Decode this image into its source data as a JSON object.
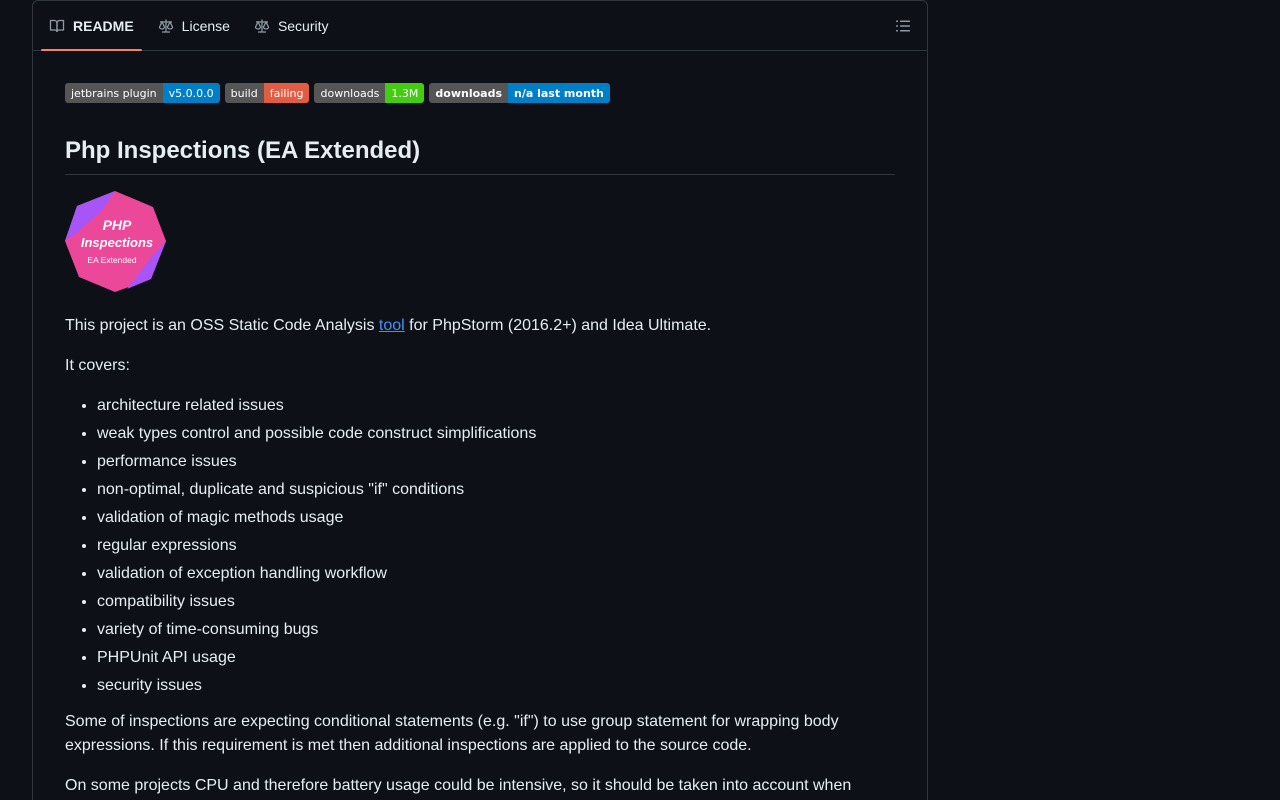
{
  "tabs": [
    {
      "label": "README",
      "icon": "book-icon",
      "active": true
    },
    {
      "label": "License",
      "icon": "scale-icon",
      "active": false
    },
    {
      "label": "Security",
      "icon": "scale-icon",
      "active": false
    }
  ],
  "badges": [
    {
      "left": "jetbrains plugin",
      "right": "v5.0.0.0",
      "color": "#007ec6"
    },
    {
      "left": "build",
      "right": "failing",
      "color": "#e05d44"
    },
    {
      "left": "downloads",
      "right": "1.3M",
      "color": "#4c1"
    },
    {
      "left": "downloads",
      "right": "n/a last month",
      "color": "#007ec6"
    }
  ],
  "title": "Php Inspections (EA Extended)",
  "logo": {
    "line1": "PHP",
    "line2": "Inspections",
    "line3": "EA Extended"
  },
  "intro": {
    "before": "This project is an OSS Static Code Analysis ",
    "link": "tool",
    "after": " for PhpStorm (2016.2+) and Idea Ultimate."
  },
  "covers": "It covers:",
  "issues": [
    "architecture related issues",
    "weak types control and possible code construct simplifications",
    "performance issues",
    "non-optimal, duplicate and suspicious \"if\" conditions",
    "validation of magic methods usage",
    "regular expressions",
    "validation of exception handling workflow",
    "compatibility issues",
    "variety of time-consuming bugs",
    "PHPUnit API usage",
    "security issues"
  ],
  "paragraph3": "Some of inspections are expecting conditional statements (e.g. \"if\") to use group statement for wrapping body expressions. If this requirement is met then additional inspections are applied to the source code.",
  "paragraph4": "On some projects CPU and therefore battery usage could be intensive, so it should be taken into account when"
}
